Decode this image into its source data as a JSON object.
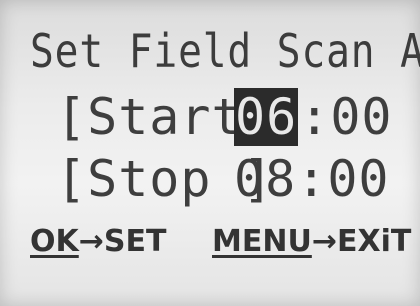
{
  "screen": {
    "title": "Set Field Scan A"
  },
  "schedule": {
    "start": {
      "label": "[Start]",
      "hour": "06",
      "separator": ":",
      "minute": "00",
      "selected": "hour"
    },
    "stop": {
      "label": "[Stop ]",
      "hour": "08",
      "separator": ":",
      "minute": "00"
    }
  },
  "footer": {
    "ok_key": "OK",
    "ok_action": "→SET",
    "menu_key": "MENU",
    "menu_action": "→EXiT"
  }
}
